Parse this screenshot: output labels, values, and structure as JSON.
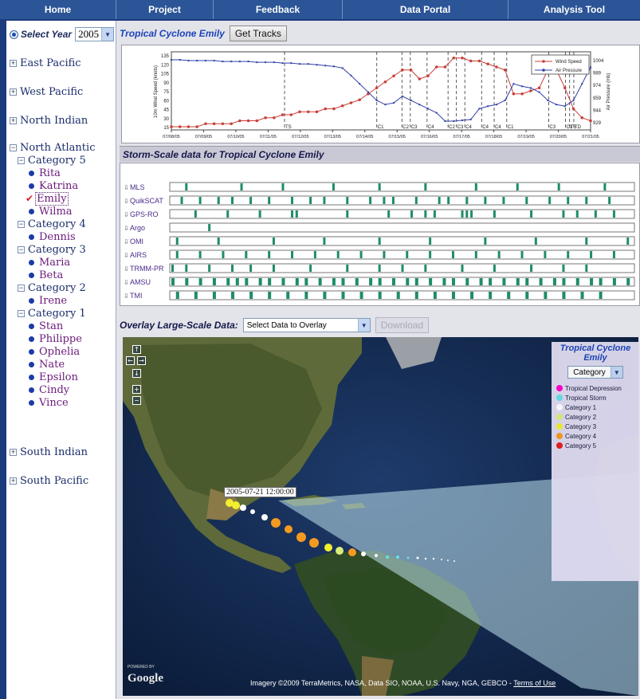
{
  "nav": [
    "Home",
    "Project",
    "Feedback",
    "Data Portal",
    "Analysis Tool"
  ],
  "sidebar": {
    "year_label": "Select Year",
    "year_value": "2005",
    "regions": [
      {
        "name": "East Pacific",
        "expanded": false
      },
      {
        "name": "West Pacific",
        "expanded": false
      },
      {
        "name": "North Indian",
        "expanded": false
      },
      {
        "name": "North Atlantic",
        "expanded": true
      },
      {
        "name": "South Indian",
        "expanded": false
      },
      {
        "name": "South Pacific",
        "expanded": false
      }
    ],
    "categories": [
      {
        "name": "Category 5",
        "storms": [
          "Rita",
          "Katrina",
          "Emily",
          "Wilma"
        ]
      },
      {
        "name": "Category 4",
        "storms": [
          "Dennis"
        ]
      },
      {
        "name": "Category 3",
        "storms": [
          "Maria",
          "Beta"
        ]
      },
      {
        "name": "Category 2",
        "storms": [
          "Irene"
        ]
      },
      {
        "name": "Category 1",
        "storms": [
          "Stan",
          "Philippe",
          "Ophelia",
          "Nate",
          "Epsilon",
          "Cindy",
          "Vince"
        ]
      }
    ],
    "selected_storm": "Emily",
    "toggle_collapsed": "+",
    "toggle_expanded": "−"
  },
  "main": {
    "storm_title": "Tropical Cyclone Emily",
    "get_tracks_label": "Get Tracks",
    "storm_scale_title": "Storm-Scale data for Tropical Cyclone Emily",
    "overlay_label": "Overlay Large-Scale Data:",
    "overlay_select": "Select Data to Overlay",
    "download_label": "Download"
  },
  "chart_data": {
    "type": "line",
    "x_labels": [
      "07/08/05",
      "07/09/05",
      "07/10/05",
      "07/11/05",
      "07/12/05",
      "07/13/05",
      "07/14/05",
      "07/15/05",
      "07/16/05",
      "07/17/05",
      "07/18/05",
      "07/19/05",
      "07/20/05",
      "07/21/05"
    ],
    "ylabel_left": "10m Wind Speed (knots)",
    "ylabel_right": "Air Pressure (mb)",
    "yticks_left": [
      "135",
      "120",
      "105",
      "90",
      "75",
      "60",
      "45",
      "30",
      "15"
    ],
    "yticks_right": [
      "1004",
      "989",
      "974",
      "959",
      "944",
      "929"
    ],
    "ylim_left": [
      15,
      135
    ],
    "ylim_right": [
      929,
      1004
    ],
    "series": [
      {
        "name": "Wind Speed",
        "color": "#c8403a",
        "values": [
          15,
          15,
          15,
          15,
          20,
          20,
          20,
          20,
          25,
          25,
          25,
          30,
          30,
          35,
          35,
          40,
          40,
          40,
          45,
          45,
          50,
          55,
          60,
          70,
          80,
          90,
          100,
          110,
          110,
          95,
          100,
          115,
          115,
          130,
          130,
          125,
          125,
          120,
          115,
          110,
          70,
          70,
          75,
          80,
          110,
          110,
          80,
          45,
          30,
          25
        ]
      },
      {
        "name": "Air Pressure",
        "color": "#3040a8",
        "values": [
          1004,
          1004,
          1003,
          1003,
          1003,
          1003,
          1002,
          1002,
          1002,
          1002,
          1001,
          1001,
          1001,
          1000,
          1000,
          999,
          999,
          998,
          997,
          996,
          994,
          985,
          975,
          965,
          955,
          950,
          952,
          960,
          955,
          950,
          945,
          940,
          930,
          930,
          931,
          932,
          945,
          948,
          950,
          955,
          975,
          972,
          970,
          965,
          955,
          950,
          948,
          955,
          975,
          995
        ]
      }
    ],
    "markers": [
      "TS",
      "C1",
      "C2",
      "C3",
      "C4",
      "C2",
      "C3",
      "C4",
      "C4",
      "C4",
      "C1",
      "C3",
      "C1",
      "TS",
      "TD"
    ],
    "legend": "top-right"
  },
  "storm_scale": {
    "instruments": [
      "MLS",
      "QuikSCAT",
      "GPS-RO",
      "Argo",
      "OMI",
      "AIRS",
      "TRMM-PR",
      "AMSU",
      "TMI"
    ],
    "dates": [
      "07-08",
      "07-09",
      "07-10",
      "07-11",
      "07-12",
      "07-13",
      "07-14",
      "07-15",
      "07-16",
      "07-17",
      "07-18",
      "07-19",
      "07-20",
      "07-21"
    ],
    "bar_color": "#1e8c6a"
  },
  "map": {
    "track_label": "2005-07-21 12:00:00",
    "copyright": "Imagery ©2009 TerraMetrics, NASA, Data SIO, NOAA, U.S. Navy, NGA, GEBCO - ",
    "terms": "Terms of Use",
    "google": "Google",
    "powered_by": "POWERED BY"
  },
  "legend": {
    "title": "Tropical Cyclone Emily",
    "select": "Category",
    "items": [
      {
        "label": "Tropical Depression",
        "color": "#ff00cc"
      },
      {
        "label": "Tropical Storm",
        "color": "#66e0e8"
      },
      {
        "label": "Category 1",
        "color": "#ffffff"
      },
      {
        "label": "Category 2",
        "color": "#d8ee7a"
      },
      {
        "label": "Category 3",
        "color": "#f2ee30"
      },
      {
        "label": "Category 4",
        "color": "#f59a20"
      },
      {
        "label": "Category 5",
        "color": "#e81e1e"
      }
    ]
  }
}
